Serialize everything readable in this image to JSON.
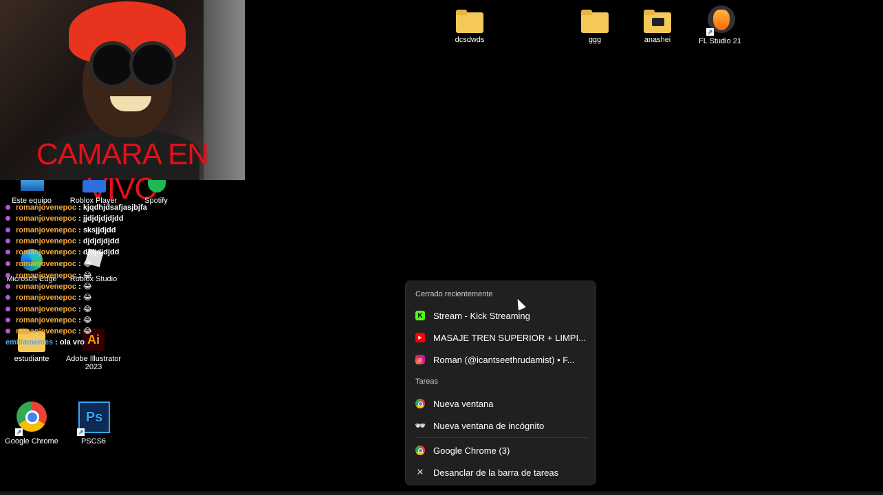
{
  "webcam": {
    "label": "CAMARA EN VIVO"
  },
  "desktop_icons": [
    {
      "label": "dcsdwds"
    },
    {
      "label": "ggg"
    },
    {
      "label": "anashei"
    },
    {
      "label": "FL Studio 21"
    },
    {
      "label": "Este equipo"
    },
    {
      "label": "Roblox Player"
    },
    {
      "label": "Spotify"
    },
    {
      "label": "Microsoft Edge"
    },
    {
      "label": "Roblox Studio"
    },
    {
      "label": "estudiante"
    },
    {
      "label": "Adobe Illustrator 2023"
    },
    {
      "label": "Google Chrome"
    },
    {
      "label": "PSCS6"
    }
  ],
  "chat": {
    "messages": [
      {
        "user": "romanjovenepoc",
        "text": "kjqdhjdsafjasjbjfa"
      },
      {
        "user": "romanjovenepoc",
        "text": "jjdjdjdjdjdd"
      },
      {
        "user": "romanjovenepoc",
        "text": "sksjjdjdd"
      },
      {
        "user": "romanjovenepoc",
        "text": "djdjdjdjdd"
      },
      {
        "user": "romanjovenepoc",
        "text": "djdjdjdjdd"
      },
      {
        "user": "romanjovenepoc",
        "text": "😂"
      },
      {
        "user": "romanjovenepoc",
        "text": "😂"
      },
      {
        "user": "romanjovenepoc",
        "text": "😂"
      },
      {
        "user": "romanjovenepoc",
        "text": "😂"
      },
      {
        "user": "romanjovenepoc",
        "text": "😂"
      },
      {
        "user": "romanjovenepoc",
        "text": "😂"
      },
      {
        "user": "romanjovenepoc",
        "text": "😂"
      },
      {
        "user": "emiliamemes",
        "text": "ola vro"
      }
    ]
  },
  "jumplist": {
    "recent_header": "Cerrado recientemente",
    "recent": [
      {
        "label": "Stream - Kick Streaming",
        "icon": "kick-icon"
      },
      {
        "label": "MASAJE TREN SUPERIOR + LIMPI...",
        "icon": "youtube-icon"
      },
      {
        "label": "Roman (@icantseethrudamist) • F...",
        "icon": "instagram-icon"
      }
    ],
    "tasks_header": "Tareas",
    "tasks": [
      {
        "label": "Nueva ventana",
        "icon": "chrome-icon"
      },
      {
        "label": "Nueva ventana de incógnito",
        "icon": "incognito-icon"
      }
    ],
    "app": {
      "label": "Google Chrome (3)",
      "icon": "chrome-icon"
    },
    "unpin": {
      "label": "Desanclar de la barra de tareas",
      "icon": "unpin-icon"
    }
  },
  "colors": {
    "menu_bg": "#202020",
    "chat_user": "#f2a93b",
    "webcam_label": "#e3101a"
  }
}
